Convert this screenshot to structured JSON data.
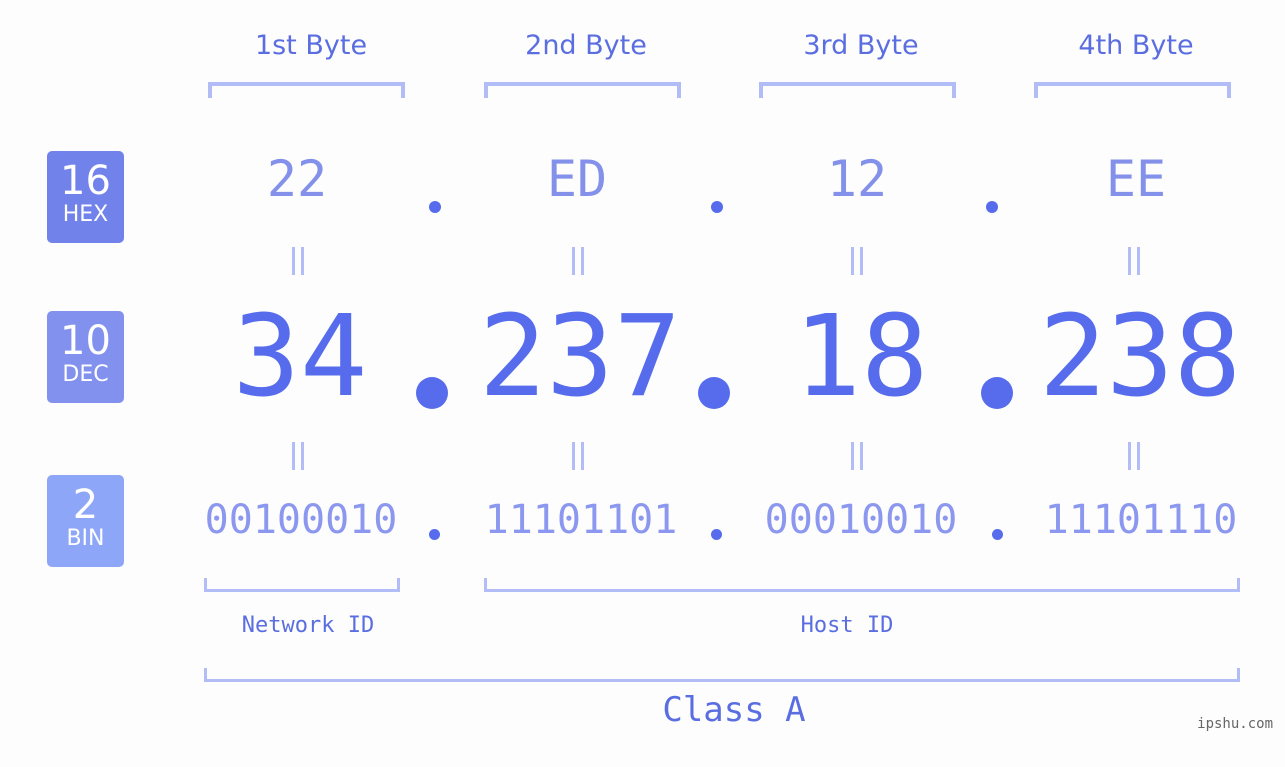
{
  "badges": [
    {
      "base": "16",
      "label": "HEX",
      "color": "#7182ea"
    },
    {
      "base": "10",
      "label": "DEC",
      "color": "#8391ee"
    },
    {
      "base": "2",
      "label": "BIN",
      "color": "#8ea6f7"
    }
  ],
  "bytes": [
    {
      "header": "1st Byte",
      "hex": "22",
      "dec": "34",
      "bin": "00100010"
    },
    {
      "header": "2nd Byte",
      "hex": "ED",
      "dec": "237",
      "bin": "11101101"
    },
    {
      "header": "3rd Byte",
      "hex": "12",
      "dec": "18",
      "bin": "00010010"
    },
    {
      "header": "4th Byte",
      "hex": "EE",
      "dec": "238",
      "bin": "11101110"
    }
  ],
  "ip": {
    "decimal": "34.237.18.238",
    "hex": "22.ED.12.EE",
    "binary": "00100010.11101101.00010010.11101110"
  },
  "segments": {
    "network": "Network ID",
    "host": "Host ID"
  },
  "ip_class": "Class A",
  "watermark": "ipshu.com",
  "colors": {
    "accent": "#566ced",
    "label": "#5b6ee1",
    "bracket": "#b2bcf6",
    "hex_text": "#8491ea",
    "bin_text": "#8c98ef"
  }
}
